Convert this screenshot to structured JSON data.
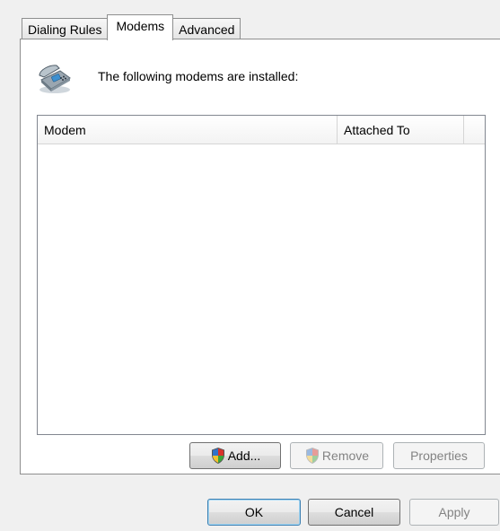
{
  "tabs": [
    {
      "label": "Dialing Rules",
      "active": false
    },
    {
      "label": "Modems",
      "active": true
    },
    {
      "label": "Advanced",
      "active": false
    }
  ],
  "modems_page": {
    "heading": "The following modems are installed:",
    "icon": "telephone-modem-icon",
    "columns": [
      "Modem",
      "Attached To"
    ],
    "rows": []
  },
  "list_buttons": {
    "add": "Add...",
    "remove": "Remove",
    "properties": "Properties"
  },
  "dialog_buttons": {
    "ok": "OK",
    "cancel": "Cancel",
    "apply": "Apply"
  },
  "colors": {
    "dialog_bg": "#f0f0f0",
    "page_bg": "#ffffff",
    "default_button_border": "#3c7fb1",
    "disabled_text": "#838383"
  }
}
